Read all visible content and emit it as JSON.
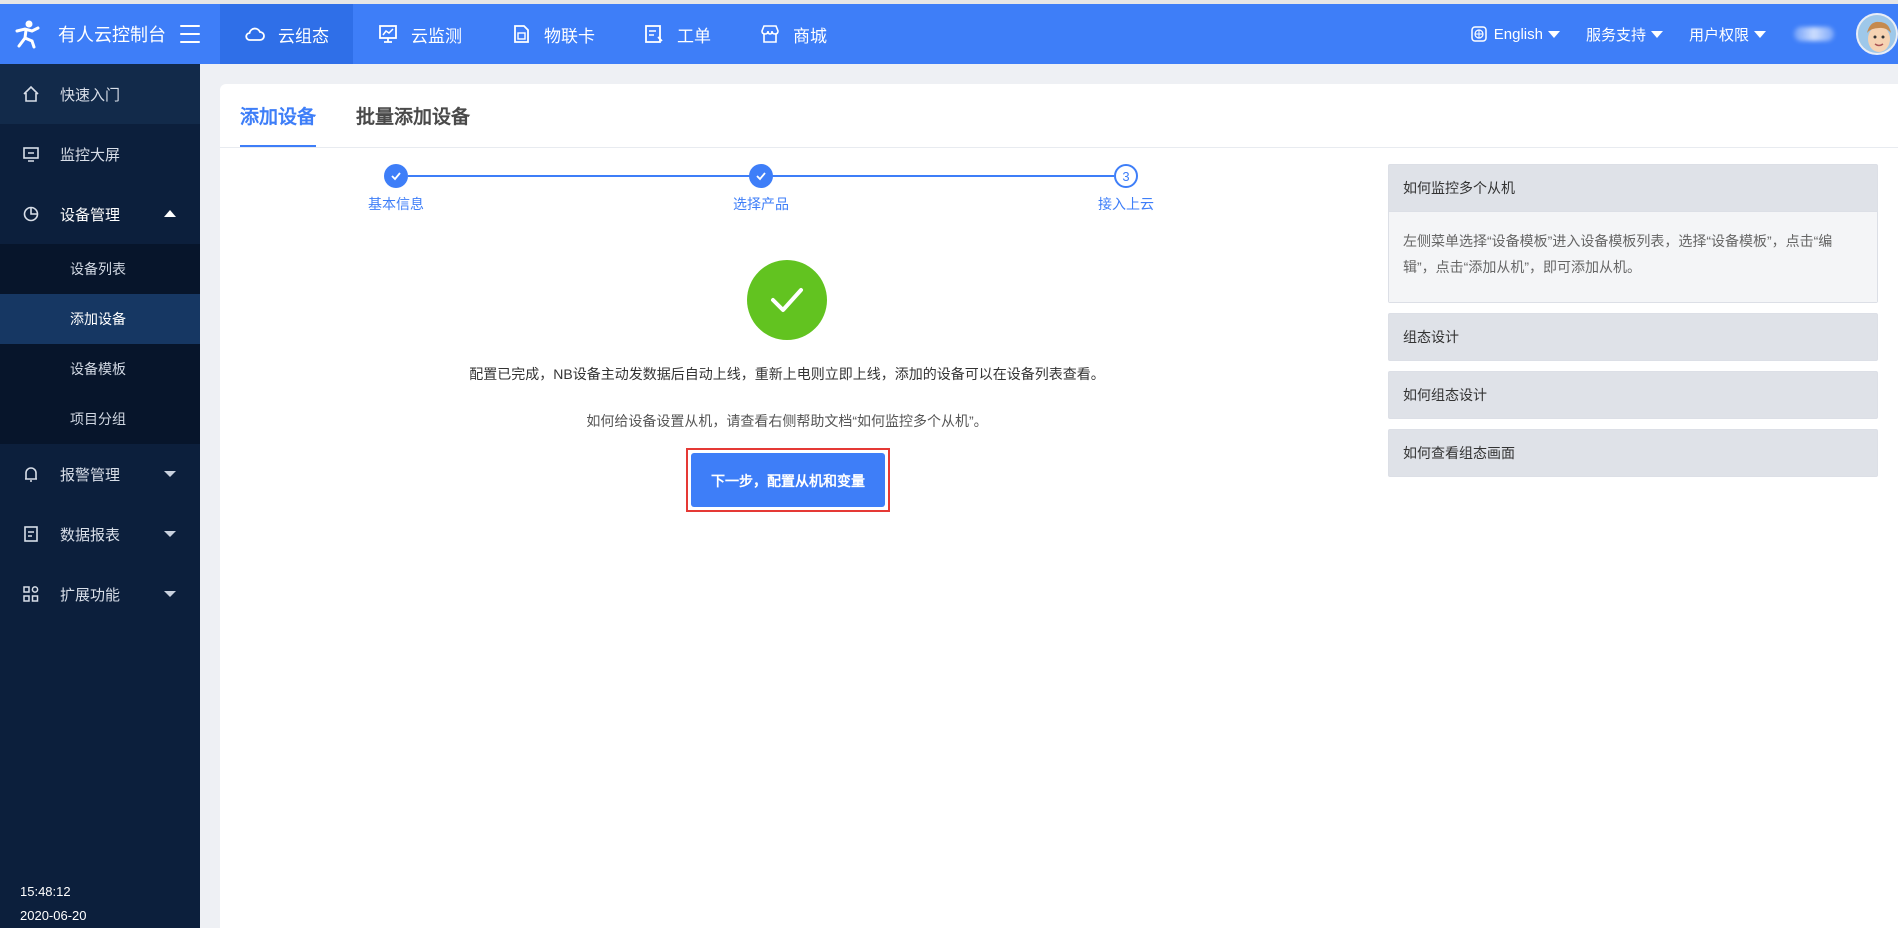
{
  "header": {
    "brand_title": "有人云控制台",
    "nav": [
      {
        "label": "云组态",
        "icon": "cloud-icon",
        "active": true
      },
      {
        "label": "云监测",
        "icon": "monitor-chart-icon",
        "active": false
      },
      {
        "label": "物联卡",
        "icon": "sim-card-icon",
        "active": false
      },
      {
        "label": "工单",
        "icon": "ticket-icon",
        "active": false
      },
      {
        "label": "商城",
        "icon": "store-icon",
        "active": false
      }
    ],
    "language": "English",
    "service": "服务支持",
    "permission": "用户权限"
  },
  "sidebar": {
    "items": [
      {
        "label": "快速入门",
        "icon": "home-icon"
      },
      {
        "label": "监控大屏",
        "icon": "screen-icon"
      },
      {
        "label": "设备管理",
        "icon": "pie-chart-icon"
      },
      {
        "label": "报警管理",
        "icon": "bell-icon"
      },
      {
        "label": "数据报表",
        "icon": "report-icon"
      },
      {
        "label": "扩展功能",
        "icon": "apps-icon"
      }
    ],
    "device_submenu": [
      "设备列表",
      "添加设备",
      "设备模板",
      "项目分组"
    ],
    "time": "15:48:12",
    "date": "2020-06-20"
  },
  "main": {
    "tabs": [
      "添加设备",
      "批量添加设备"
    ],
    "steps": [
      {
        "label": "基本信息",
        "state": "done"
      },
      {
        "label": "选择产品",
        "state": "done"
      },
      {
        "label": "接入上云",
        "state": "current",
        "number": "3"
      }
    ],
    "message": "配置已完成，NB设备主动发数据后自动上线，重新上电则立即上线，添加的设备可以在设备列表查看。",
    "hint": "如何给设备设置从机，请查看右侧帮助文档“如何监控多个从机”。",
    "next_button": "下一步，配置从机和变量"
  },
  "help": {
    "items": [
      {
        "title": "如何监控多个从机",
        "body": "左侧菜单选择“设备模板”进入设备模板列表，选择“设备模板”，点击“编辑”，点击“添加从机”，即可添加从机。"
      },
      {
        "title": "组态设计"
      },
      {
        "title": "如何组态设计"
      },
      {
        "title": "如何查看组态画面"
      }
    ]
  },
  "colors": {
    "primary": "#3e7ef8",
    "sidebar": "#0c1f3c",
    "success": "#62c320",
    "highlight": "#e53935"
  }
}
